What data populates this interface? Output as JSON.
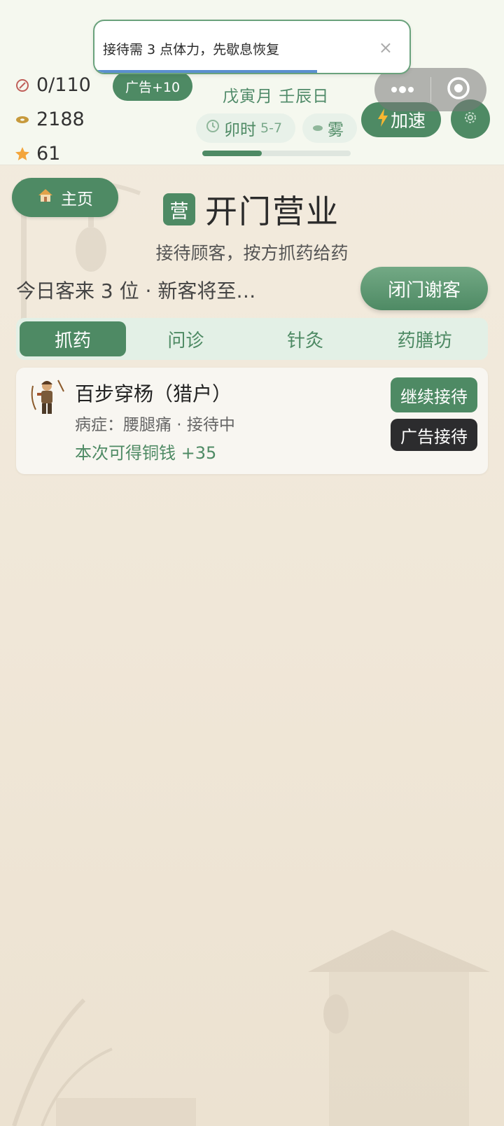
{
  "toast": {
    "message": "接待需 3 点体力，先歇息恢复",
    "close_glyph": "×"
  },
  "header": {
    "stamina": "0/110",
    "coins": "2188",
    "stars": "61",
    "ad_bonus": "广告+10",
    "date": "戊寅月 壬辰日",
    "time_label": "卯时",
    "time_range": "5-7",
    "weather": "雾",
    "speed_label": "加速",
    "day_progress": 0.4,
    "icons": {
      "stamina": "stamina-icon",
      "coins": "coin-icon",
      "stars": "star-icon",
      "time": "clock-icon",
      "weather": "fog-icon",
      "speed": "lightning-icon",
      "settings": "gear-icon",
      "menu": "more-dots-icon",
      "close_app": "target-circle-icon"
    }
  },
  "main": {
    "home_label": "主页",
    "title_badge": "营",
    "title": "开门营业",
    "subtitle": "接待顾客，按方抓药给药",
    "status": "今日客来 3 位 · 新客将至…",
    "close_shop_label": "闭门谢客",
    "tabs": [
      {
        "label": "抓药",
        "active": true
      },
      {
        "label": "问诊",
        "active": false
      },
      {
        "label": "针灸",
        "active": false
      },
      {
        "label": "药膳坊",
        "active": false
      }
    ]
  },
  "customer": {
    "name": "百步穿杨（猎户）",
    "info": "病症：腰腿痛 · 接待中",
    "reward": "本次可得铜钱 +35",
    "continue_label": "继续接待",
    "ad_label": "广告接待"
  },
  "colors": {
    "accent": "#4e8a64",
    "dark_button": "#2c2c2e",
    "background": "#f1e9dc",
    "header_bg": "#f5f8ef",
    "toast_bar": "#5b8fcf"
  }
}
